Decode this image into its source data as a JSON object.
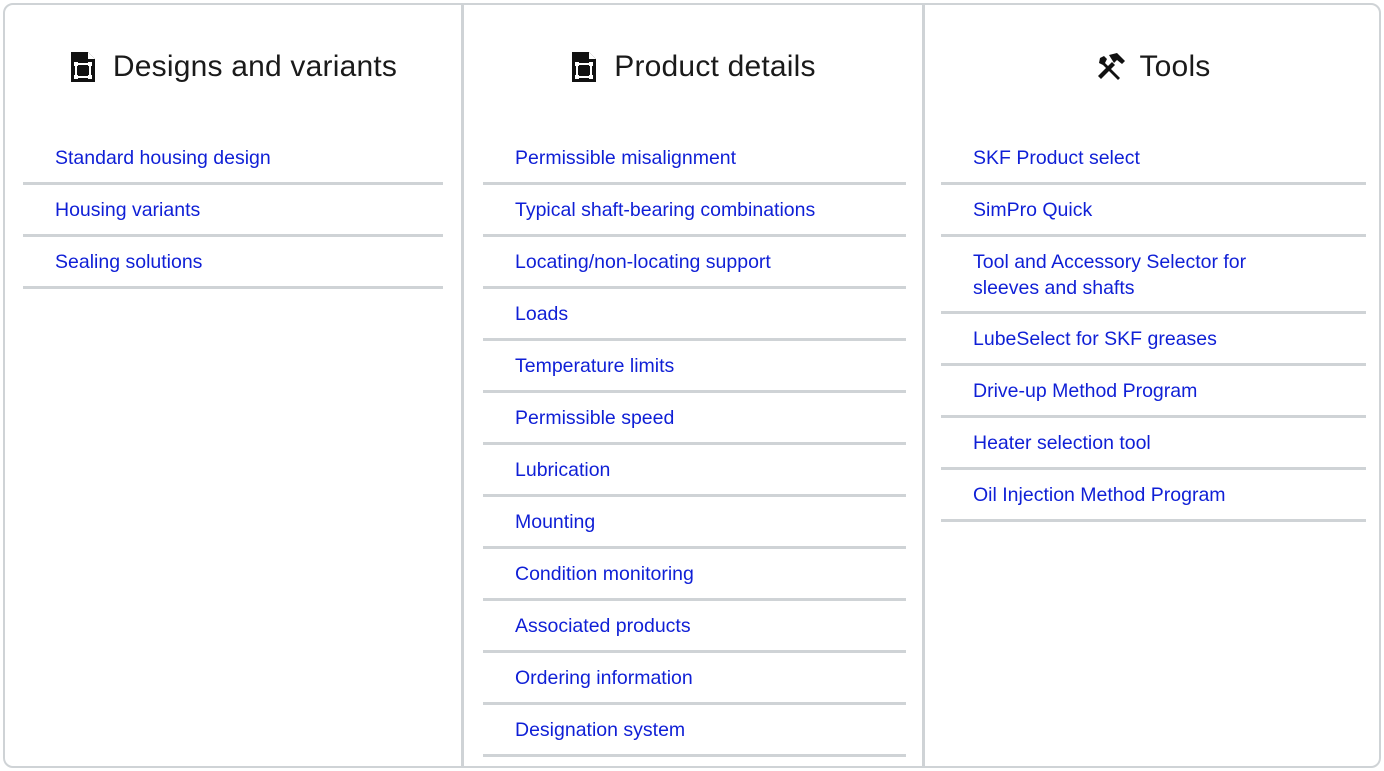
{
  "columns": [
    {
      "title": "Designs and variants",
      "icon": "document-icon",
      "links": [
        "Standard housing design",
        "Housing variants",
        "Sealing solutions"
      ]
    },
    {
      "title": "Product details",
      "icon": "document-icon",
      "links": [
        "Permissible misalignment",
        "Typical shaft-bearing combinations",
        "Locating/non-locating support",
        "Loads",
        "Temperature limits",
        "Permissible speed",
        "Lubrication",
        "Mounting",
        "Condition monitoring",
        "Associated products",
        "Ordering information",
        "Designation system"
      ]
    },
    {
      "title": "Tools",
      "icon": "tools-icon",
      "links": [
        "SKF Product select",
        "SimPro Quick",
        "Tool and Accessory Selector for sleeves and shafts",
        "LubeSelect for SKF greases",
        "Drive-up Method Program",
        "Heater selection tool",
        "Oil Injection Method Program"
      ]
    }
  ],
  "colors": {
    "link": "#0f1fd6",
    "divider": "#cfd3d6",
    "heading": "#1a1a1a"
  }
}
